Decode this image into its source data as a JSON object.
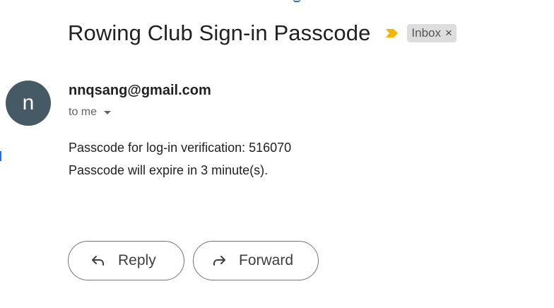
{
  "email": {
    "subject": "Rowing Club Sign-in Passcode",
    "label_chip": "Inbox",
    "label_chip_close": "×",
    "importance_marker_color": "#f4b400",
    "sender": {
      "avatar_letter": "n",
      "avatar_color": "#455a64",
      "address": "nnqsang@gmail.com"
    },
    "recipient_summary": "to me",
    "body_lines": [
      "Passcode for log-in verification: 516070",
      "Passcode will expire in 3 minute(s)."
    ]
  },
  "actions": {
    "reply": {
      "label": "Reply",
      "icon": "reply-icon"
    },
    "forward": {
      "label": "Forward",
      "icon": "forward-icon"
    }
  }
}
